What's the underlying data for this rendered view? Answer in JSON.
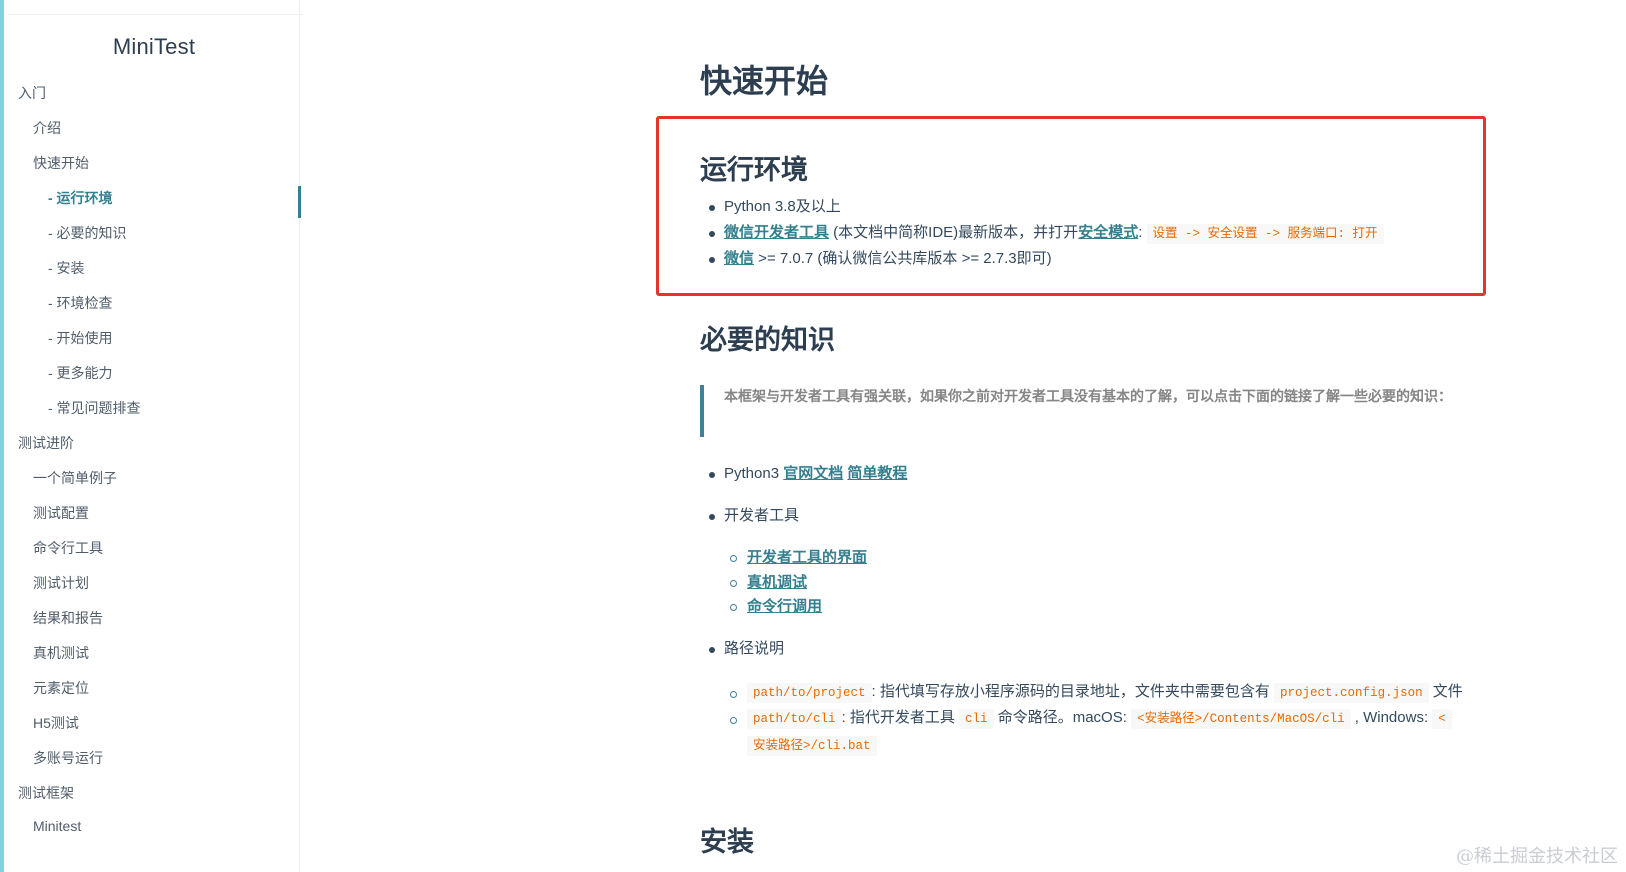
{
  "sidebar": {
    "app_name": "MiniTest",
    "items": [
      {
        "label": "入门"
      },
      {
        "label": "介绍"
      },
      {
        "label": "快速开始"
      },
      {
        "label": "- 运行环境"
      },
      {
        "label": "- 必要的知识"
      },
      {
        "label": "- 安装"
      },
      {
        "label": "- 环境检查"
      },
      {
        "label": "- 开始使用"
      },
      {
        "label": "- 更多能力"
      },
      {
        "label": "- 常见问题排查"
      },
      {
        "label": "测试进阶"
      },
      {
        "label": "一个简单例子"
      },
      {
        "label": "测试配置"
      },
      {
        "label": "命令行工具"
      },
      {
        "label": "测试计划"
      },
      {
        "label": "结果和报告"
      },
      {
        "label": "真机测试"
      },
      {
        "label": "元素定位"
      },
      {
        "label": "H5测试"
      },
      {
        "label": "多账号运行"
      },
      {
        "label": "测试框架"
      },
      {
        "label": "Minitest"
      }
    ]
  },
  "main": {
    "title": "快速开始",
    "env": {
      "heading": "运行环境",
      "item1": "Python 3.8及以上",
      "item2_link": "微信开发者工具",
      "item2_text": " (本文档中简称IDE)最新版本，并打开",
      "item2_link2": "安全模式",
      "item2_colon": ": ",
      "item2_code": "设置 -> 安全设置 -> 服务端口: 打开",
      "item3_link": "微信",
      "item3_text": " >= 7.0.7 (确认微信公共库版本 >= 2.7.3即可)"
    },
    "knowledge": {
      "heading": "必要的知识",
      "quote": "本框架与开发者工具有强关联，如果你之前对开发者工具没有基本的了解，可以点击下面的链接了解一些必要的知识：",
      "python_prefix": "Python3 ",
      "python_link1": "官网文档",
      "python_link2": "简单教程",
      "devtools": "开发者工具",
      "devtools_links": [
        "开发者工具的界面",
        "真机调试",
        "命令行调用"
      ],
      "paths": "路径说明",
      "path1_code": "path/to/project",
      "path1_text": ": 指代填写存放小程序源码的目录地址，文件夹中需要包含有",
      "path1_code2": "project.config.json",
      "path1_tail": " 文件",
      "path2_code": "path/to/cli",
      "path2_text": ": 指代开发者工具",
      "path2_code2": "cli",
      "path2_text2": " 命令路径。macOS: ",
      "path2_code3": "<安装路径>/Contents/MacOS/cli",
      "path2_text3": " ,  Windows: ",
      "path2_code4a": "<",
      "path2_code4b": "安装路径>/cli.bat"
    },
    "install": {
      "heading": "安装"
    },
    "watermark": "@稀土掘金技术社区"
  }
}
